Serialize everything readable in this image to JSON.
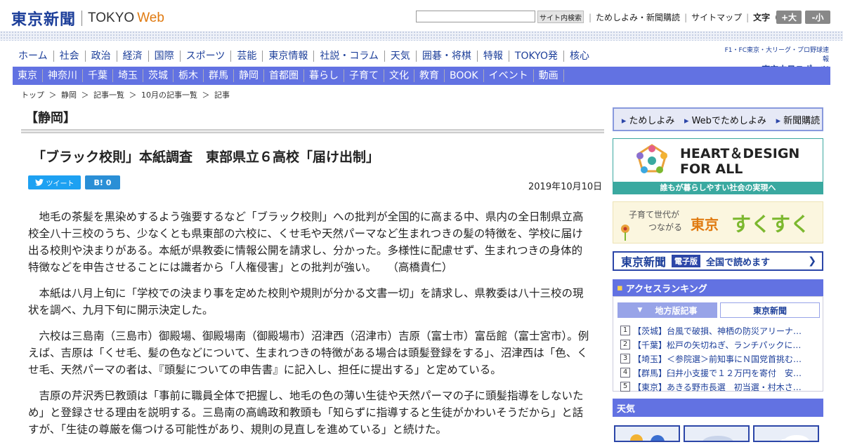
{
  "header": {
    "logo_jp": "東京新聞",
    "logo_en": "TOKYO",
    "logo_web": "Web",
    "search_button": "サイト内検索",
    "links": [
      "ためしよみ・新聞購読",
      "サイトマップ"
    ],
    "font_size_label": "文字（0）",
    "font_larger": "+大",
    "font_smaller": "-小"
  },
  "main_nav": [
    "ホーム",
    "社会",
    "政治",
    "経済",
    "国際",
    "スポーツ",
    "芸能",
    "東京情報",
    "社説・コラム",
    "天気",
    "囲碁・将棋",
    "特報",
    "TOKYO発",
    "核心"
  ],
  "chunichi": {
    "small": "F1・FC東京・大リーグ・プロ野球速報",
    "big": "東京中日スポーツ"
  },
  "sub_nav": [
    "東京",
    "神奈川",
    "千葉",
    "埼玉",
    "茨城",
    "栃木",
    "群馬",
    "静岡",
    "首都圏",
    "暮らし",
    "子育て",
    "文化",
    "教育",
    "BOOK",
    "イベント",
    "動画"
  ],
  "breadcrumb": [
    "トップ",
    "＞",
    "静岡",
    "＞",
    "記事一覧",
    "＞",
    "10月の記事一覧",
    "＞",
    "記事"
  ],
  "article": {
    "section": "【静岡】",
    "headline": "「ブラック校則」本紙調査　東部県立６高校「届け出制」",
    "tweet": "ツイート",
    "hatena": "B! 0",
    "date": "2019年10月10日",
    "paragraphs": [
      "地毛の茶髪を黒染めするよう強要するなど「ブラック校則」への批判が全国的に高まる中、県内の全日制県立高校全八十三校のうち、少なくとも県東部の六校に、くせ毛や天然パーマなど生まれつきの髪の特徴を、学校に届け出る校則や決まりがある。本紙が県教委に情報公開を請求し、分かった。多様性に配慮せず、生まれつきの身体的特徴などを申告させることには識者から「人権侵害」との批判が強い。　　（高橋貴仁）",
      "本紙は八月上旬に「学校での決まり事を定めた校則や規則が分かる文書一切」を請求し、県教委は八十三校の現状を調べ、九月下旬に開示決定した。",
      "六校は三島南（三島市）御殿場、御殿場南（御殿場市）沼津西（沼津市）吉原（富士市）富岳館（富士宮市）。例えば、吉原は「くせ毛、髪の色などについて、生まれつきの特徴がある場合は頭髪登録をする」、沼津西は「色、くせ毛、天然パーマの者は、『頭髪についての申告書』に記入し、担任に提出する」と定めている。",
      "吉原の芹沢秀巳教頭は「事前に職員全体で把握し、地毛の色の薄い生徒や天然パーマの子に頭髪指導をしないため」と登録させる理由を説明する。三島南の高嶋政和教頭も「知らずに指導すると生徒がかわいそうだから」と話すが、「生徒の尊厳を傷つける可能性があり、規則の見直しを進めている」と続けた。"
    ]
  },
  "sidebar": {
    "links": [
      "ためしよみ",
      "Webでためしよみ",
      "新聞購読"
    ],
    "heart_title_1": "HEART＆DESIGN",
    "heart_title_2": "FOR ALL",
    "heart_footer": "誰もが暮らしやすい社会の実現へ",
    "suku_sub_1": "子育て世代が",
    "suku_sub_2": "つながる",
    "suku_tokyo": "東京",
    "suku_main": "すくすく",
    "edition_logo": "東京新聞",
    "edition_badge": "電子版",
    "edition_text": "全国で読めます",
    "ranking_title": "アクセスランキング",
    "ranking_tabs": [
      "地方版記事",
      "東京新聞"
    ],
    "ranking": [
      {
        "n": "1",
        "t": "【茨城】台風で破損、神栖の防災アリーナ…"
      },
      {
        "n": "2",
        "t": "【千葉】松戸の矢切ねぎ、ランチパックに…"
      },
      {
        "n": "3",
        "t": "【埼玉】＜参院選＞前知事にＮ国党首挑む…"
      },
      {
        "n": "4",
        "t": "【群馬】臼井小支援で１２万円を寄付　安…"
      },
      {
        "n": "5",
        "t": "【東京】あきる野市長選　初当選・村木さ…"
      }
    ],
    "weather_title": "天気"
  },
  "colors": {
    "brand_blue": "#1d3f9a",
    "nav_blue": "#6272e2",
    "accent_orange": "#e07a10",
    "teal": "#3aa9a0"
  }
}
